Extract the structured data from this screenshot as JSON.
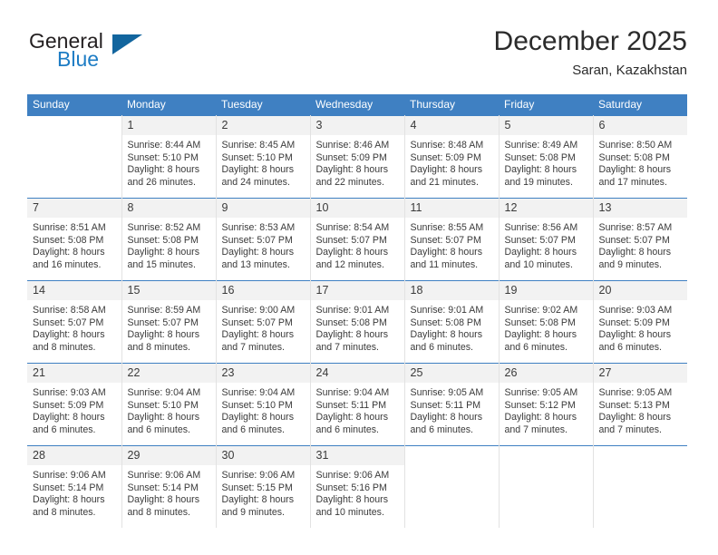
{
  "brand": {
    "name_top": "General",
    "name_bottom": "Blue",
    "accent_color": "#1d7cc4",
    "triangle_color": "#12659e",
    "triangle_icon": "triangle-icon"
  },
  "header": {
    "title": "December 2025",
    "subtitle": "Saran, Kazakhstan"
  },
  "calendar": {
    "header_background": "#3f80c2",
    "daynum_background": "#f2f2f2",
    "weekdays": [
      "Sunday",
      "Monday",
      "Tuesday",
      "Wednesday",
      "Thursday",
      "Friday",
      "Saturday"
    ],
    "weeks": [
      [
        {
          "day": "",
          "sunrise": "",
          "sunset": "",
          "daylight_line1": "",
          "daylight_line2": ""
        },
        {
          "day": "1",
          "sunrise": "Sunrise: 8:44 AM",
          "sunset": "Sunset: 5:10 PM",
          "daylight_line1": "Daylight: 8 hours",
          "daylight_line2": "and 26 minutes."
        },
        {
          "day": "2",
          "sunrise": "Sunrise: 8:45 AM",
          "sunset": "Sunset: 5:10 PM",
          "daylight_line1": "Daylight: 8 hours",
          "daylight_line2": "and 24 minutes."
        },
        {
          "day": "3",
          "sunrise": "Sunrise: 8:46 AM",
          "sunset": "Sunset: 5:09 PM",
          "daylight_line1": "Daylight: 8 hours",
          "daylight_line2": "and 22 minutes."
        },
        {
          "day": "4",
          "sunrise": "Sunrise: 8:48 AM",
          "sunset": "Sunset: 5:09 PM",
          "daylight_line1": "Daylight: 8 hours",
          "daylight_line2": "and 21 minutes."
        },
        {
          "day": "5",
          "sunrise": "Sunrise: 8:49 AM",
          "sunset": "Sunset: 5:08 PM",
          "daylight_line1": "Daylight: 8 hours",
          "daylight_line2": "and 19 minutes."
        },
        {
          "day": "6",
          "sunrise": "Sunrise: 8:50 AM",
          "sunset": "Sunset: 5:08 PM",
          "daylight_line1": "Daylight: 8 hours",
          "daylight_line2": "and 17 minutes."
        }
      ],
      [
        {
          "day": "7",
          "sunrise": "Sunrise: 8:51 AM",
          "sunset": "Sunset: 5:08 PM",
          "daylight_line1": "Daylight: 8 hours",
          "daylight_line2": "and 16 minutes."
        },
        {
          "day": "8",
          "sunrise": "Sunrise: 8:52 AM",
          "sunset": "Sunset: 5:08 PM",
          "daylight_line1": "Daylight: 8 hours",
          "daylight_line2": "and 15 minutes."
        },
        {
          "day": "9",
          "sunrise": "Sunrise: 8:53 AM",
          "sunset": "Sunset: 5:07 PM",
          "daylight_line1": "Daylight: 8 hours",
          "daylight_line2": "and 13 minutes."
        },
        {
          "day": "10",
          "sunrise": "Sunrise: 8:54 AM",
          "sunset": "Sunset: 5:07 PM",
          "daylight_line1": "Daylight: 8 hours",
          "daylight_line2": "and 12 minutes."
        },
        {
          "day": "11",
          "sunrise": "Sunrise: 8:55 AM",
          "sunset": "Sunset: 5:07 PM",
          "daylight_line1": "Daylight: 8 hours",
          "daylight_line2": "and 11 minutes."
        },
        {
          "day": "12",
          "sunrise": "Sunrise: 8:56 AM",
          "sunset": "Sunset: 5:07 PM",
          "daylight_line1": "Daylight: 8 hours",
          "daylight_line2": "and 10 minutes."
        },
        {
          "day": "13",
          "sunrise": "Sunrise: 8:57 AM",
          "sunset": "Sunset: 5:07 PM",
          "daylight_line1": "Daylight: 8 hours",
          "daylight_line2": "and 9 minutes."
        }
      ],
      [
        {
          "day": "14",
          "sunrise": "Sunrise: 8:58 AM",
          "sunset": "Sunset: 5:07 PM",
          "daylight_line1": "Daylight: 8 hours",
          "daylight_line2": "and 8 minutes."
        },
        {
          "day": "15",
          "sunrise": "Sunrise: 8:59 AM",
          "sunset": "Sunset: 5:07 PM",
          "daylight_line1": "Daylight: 8 hours",
          "daylight_line2": "and 8 minutes."
        },
        {
          "day": "16",
          "sunrise": "Sunrise: 9:00 AM",
          "sunset": "Sunset: 5:07 PM",
          "daylight_line1": "Daylight: 8 hours",
          "daylight_line2": "and 7 minutes."
        },
        {
          "day": "17",
          "sunrise": "Sunrise: 9:01 AM",
          "sunset": "Sunset: 5:08 PM",
          "daylight_line1": "Daylight: 8 hours",
          "daylight_line2": "and 7 minutes."
        },
        {
          "day": "18",
          "sunrise": "Sunrise: 9:01 AM",
          "sunset": "Sunset: 5:08 PM",
          "daylight_line1": "Daylight: 8 hours",
          "daylight_line2": "and 6 minutes."
        },
        {
          "day": "19",
          "sunrise": "Sunrise: 9:02 AM",
          "sunset": "Sunset: 5:08 PM",
          "daylight_line1": "Daylight: 8 hours",
          "daylight_line2": "and 6 minutes."
        },
        {
          "day": "20",
          "sunrise": "Sunrise: 9:03 AM",
          "sunset": "Sunset: 5:09 PM",
          "daylight_line1": "Daylight: 8 hours",
          "daylight_line2": "and 6 minutes."
        }
      ],
      [
        {
          "day": "21",
          "sunrise": "Sunrise: 9:03 AM",
          "sunset": "Sunset: 5:09 PM",
          "daylight_line1": "Daylight: 8 hours",
          "daylight_line2": "and 6 minutes."
        },
        {
          "day": "22",
          "sunrise": "Sunrise: 9:04 AM",
          "sunset": "Sunset: 5:10 PM",
          "daylight_line1": "Daylight: 8 hours",
          "daylight_line2": "and 6 minutes."
        },
        {
          "day": "23",
          "sunrise": "Sunrise: 9:04 AM",
          "sunset": "Sunset: 5:10 PM",
          "daylight_line1": "Daylight: 8 hours",
          "daylight_line2": "and 6 minutes."
        },
        {
          "day": "24",
          "sunrise": "Sunrise: 9:04 AM",
          "sunset": "Sunset: 5:11 PM",
          "daylight_line1": "Daylight: 8 hours",
          "daylight_line2": "and 6 minutes."
        },
        {
          "day": "25",
          "sunrise": "Sunrise: 9:05 AM",
          "sunset": "Sunset: 5:11 PM",
          "daylight_line1": "Daylight: 8 hours",
          "daylight_line2": "and 6 minutes."
        },
        {
          "day": "26",
          "sunrise": "Sunrise: 9:05 AM",
          "sunset": "Sunset: 5:12 PM",
          "daylight_line1": "Daylight: 8 hours",
          "daylight_line2": "and 7 minutes."
        },
        {
          "day": "27",
          "sunrise": "Sunrise: 9:05 AM",
          "sunset": "Sunset: 5:13 PM",
          "daylight_line1": "Daylight: 8 hours",
          "daylight_line2": "and 7 minutes."
        }
      ],
      [
        {
          "day": "28",
          "sunrise": "Sunrise: 9:06 AM",
          "sunset": "Sunset: 5:14 PM",
          "daylight_line1": "Daylight: 8 hours",
          "daylight_line2": "and 8 minutes."
        },
        {
          "day": "29",
          "sunrise": "Sunrise: 9:06 AM",
          "sunset": "Sunset: 5:14 PM",
          "daylight_line1": "Daylight: 8 hours",
          "daylight_line2": "and 8 minutes."
        },
        {
          "day": "30",
          "sunrise": "Sunrise: 9:06 AM",
          "sunset": "Sunset: 5:15 PM",
          "daylight_line1": "Daylight: 8 hours",
          "daylight_line2": "and 9 minutes."
        },
        {
          "day": "31",
          "sunrise": "Sunrise: 9:06 AM",
          "sunset": "Sunset: 5:16 PM",
          "daylight_line1": "Daylight: 8 hours",
          "daylight_line2": "and 10 minutes."
        },
        {
          "day": "",
          "sunrise": "",
          "sunset": "",
          "daylight_line1": "",
          "daylight_line2": ""
        },
        {
          "day": "",
          "sunrise": "",
          "sunset": "",
          "daylight_line1": "",
          "daylight_line2": ""
        },
        {
          "day": "",
          "sunrise": "",
          "sunset": "",
          "daylight_line1": "",
          "daylight_line2": ""
        }
      ]
    ]
  }
}
